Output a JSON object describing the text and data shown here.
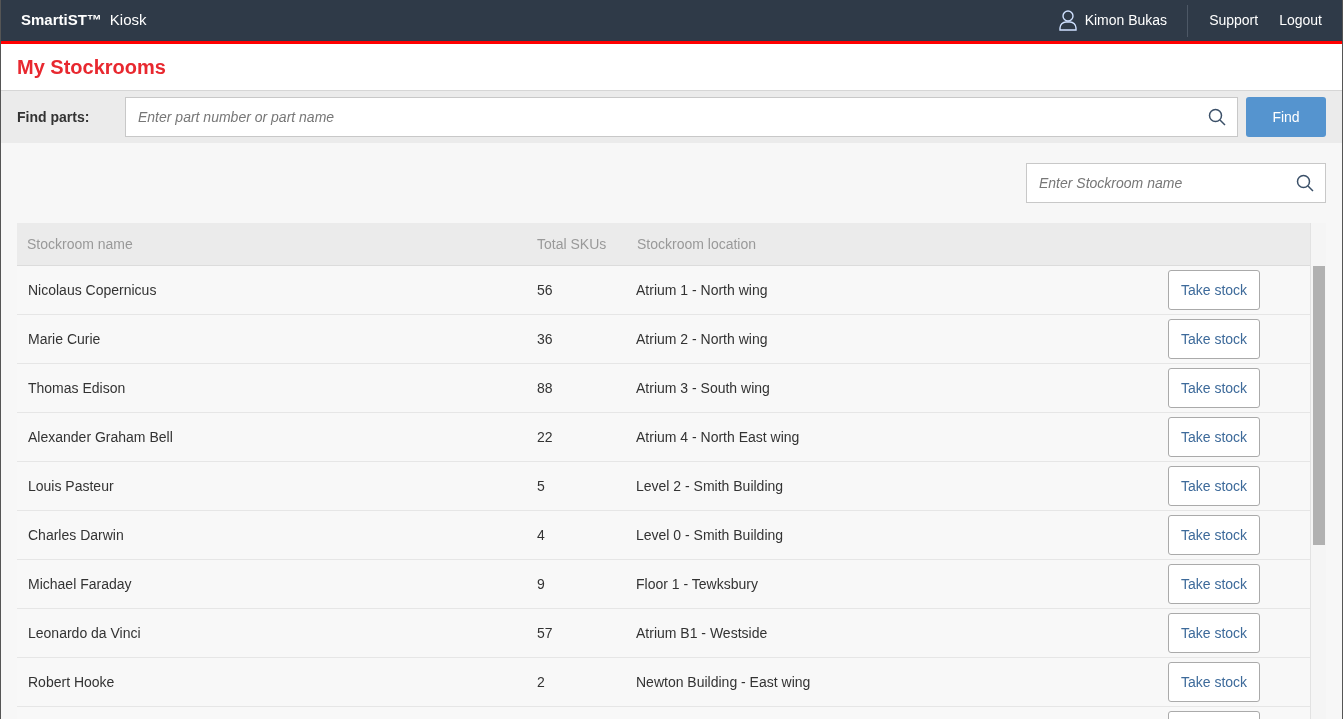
{
  "header": {
    "brand": "SmartiST™",
    "app": "Kiosk",
    "user": "Kimon Bukas",
    "links": [
      "Support",
      "Logout"
    ]
  },
  "page_title": "My Stockrooms",
  "find_parts": {
    "label": "Find parts:",
    "placeholder": "Enter part number or part name",
    "button": "Find"
  },
  "stockroom_search": {
    "placeholder": "Enter Stockroom name"
  },
  "table": {
    "columns": [
      "Stockroom name",
      "Total SKUs",
      "Stockroom location"
    ],
    "rows": [
      {
        "name": "Nicolaus Copernicus",
        "skus": "56",
        "location": "Atrium 1 - North wing",
        "action": "Take stock"
      },
      {
        "name": "Marie Curie",
        "skus": "36",
        "location": "Atrium 2 - North wing",
        "action": "Take stock"
      },
      {
        "name": "Thomas Edison",
        "skus": "88",
        "location": "Atrium 3 - South wing",
        "action": "Take stock"
      },
      {
        "name": "Alexander Graham Bell",
        "skus": "22",
        "location": "Atrium 4 - North East wing",
        "action": "Take stock"
      },
      {
        "name": "Louis Pasteur",
        "skus": "5",
        "location": "Level 2 - Smith Building",
        "action": "Take stock"
      },
      {
        "name": "Charles Darwin",
        "skus": "4",
        "location": "Level 0 - Smith Building",
        "action": "Take stock"
      },
      {
        "name": "Michael Faraday",
        "skus": "9",
        "location": "Floor 1 - Tewksbury",
        "action": "Take stock"
      },
      {
        "name": "Leonardo da Vinci",
        "skus": "57",
        "location": "Atrium B1 - Westside",
        "action": "Take stock"
      },
      {
        "name": "Robert Hooke",
        "skus": "2",
        "location": "Newton Building - East wing",
        "action": "Take stock"
      }
    ]
  }
}
